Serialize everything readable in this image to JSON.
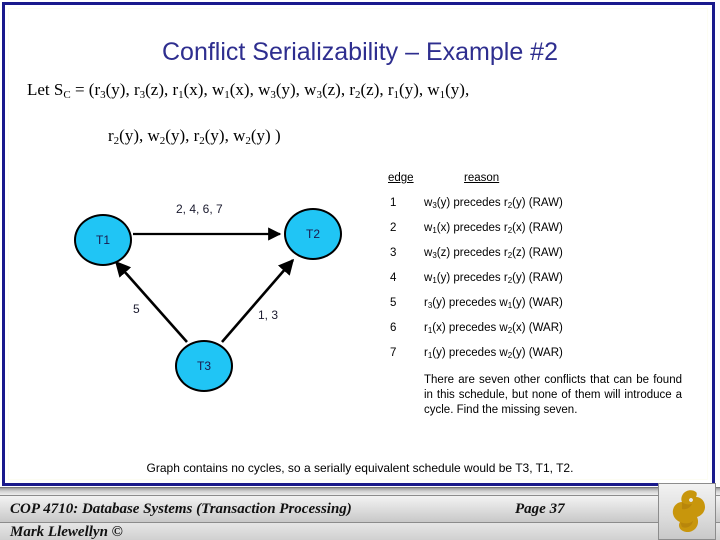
{
  "slide": {
    "title": "Conflict Serializability – Example #2",
    "schedule_line_1_prefix": "Let S",
    "schedule_line_1_sub": "C",
    "schedule_line_1_rest": " = (r3(y), r3(z), r1(x), w1(x), w3(y), w3(z), r2(z), r1(y), w1(y),",
    "schedule_line_2": "r2(y), w2(y), r2(y), w2(y) )",
    "conclusion": "Graph contains no cycles, so a serially equivalent schedule would be T3, T1, T2.",
    "note": "There are seven other conflicts that can be found in this schedule, but none of them will introduce a cycle.  Find the missing seven."
  },
  "graph": {
    "nodes": [
      {
        "id": "T1",
        "label": "T1"
      },
      {
        "id": "T2",
        "label": "T2"
      },
      {
        "id": "T3",
        "label": "T3"
      }
    ],
    "edges": [
      {
        "from": "T1",
        "to": "T2",
        "label": "2, 4, 6, 7"
      },
      {
        "from": "T3",
        "to": "T1",
        "label": "5"
      },
      {
        "from": "T3",
        "to": "T2",
        "label": "1, 3"
      }
    ],
    "node_fill": "#20c5f5",
    "node_stroke": "#000000"
  },
  "table": {
    "headers": {
      "edge": "edge",
      "reason": "reason"
    },
    "rows": [
      {
        "num": "1",
        "op1": "w",
        "op1sub": "3",
        "op1var": "(y)",
        "mid": " precedes ",
        "op2": "r",
        "op2sub": "2",
        "op2var": "(y)",
        "type": "  (RAW)"
      },
      {
        "num": "2",
        "op1": "w",
        "op1sub": "1",
        "op1var": "(x)",
        "mid": " precedes ",
        "op2": "r",
        "op2sub": "2",
        "op2var": "(x)",
        "type": "  (RAW)"
      },
      {
        "num": "3",
        "op1": "w",
        "op1sub": "3",
        "op1var": "(z)",
        "mid": " precedes ",
        "op2": "r",
        "op2sub": "2",
        "op2var": "(z)",
        "type": "  (RAW)"
      },
      {
        "num": "4",
        "op1": "w",
        "op1sub": "1",
        "op1var": "(y)",
        "mid": " precedes ",
        "op2": "r",
        "op2sub": "2",
        "op2var": "(y)",
        "type": "  (RAW)"
      },
      {
        "num": "5",
        "op1": "r",
        "op1sub": "3",
        "op1var": "(y)",
        "mid": " precedes ",
        "op2": "w",
        "op2sub": "1",
        "op2var": "(y)",
        "type": "  (WAR)"
      },
      {
        "num": "6",
        "op1": "r",
        "op1sub": "1",
        "op1var": "(x)",
        "mid": " precedes ",
        "op2": "w",
        "op2sub": "2",
        "op2var": "(x)",
        "type": "  (WAR)"
      },
      {
        "num": "7",
        "op1": "r",
        "op1sub": "1",
        "op1var": "(y)",
        "mid": " precedes ",
        "op2": "w",
        "op2sub": "2",
        "op2var": "(y)",
        "type": "  (WAR)"
      }
    ]
  },
  "footer": {
    "course": "COP 4710: Database Systems  (Transaction Processing)",
    "page": "Page 37",
    "author": "Mark Llewellyn ©"
  },
  "colors": {
    "title": "#2e2e8f",
    "frame": "#1a1a8c",
    "node": "#20c5f5",
    "logo": "#c8960c"
  }
}
